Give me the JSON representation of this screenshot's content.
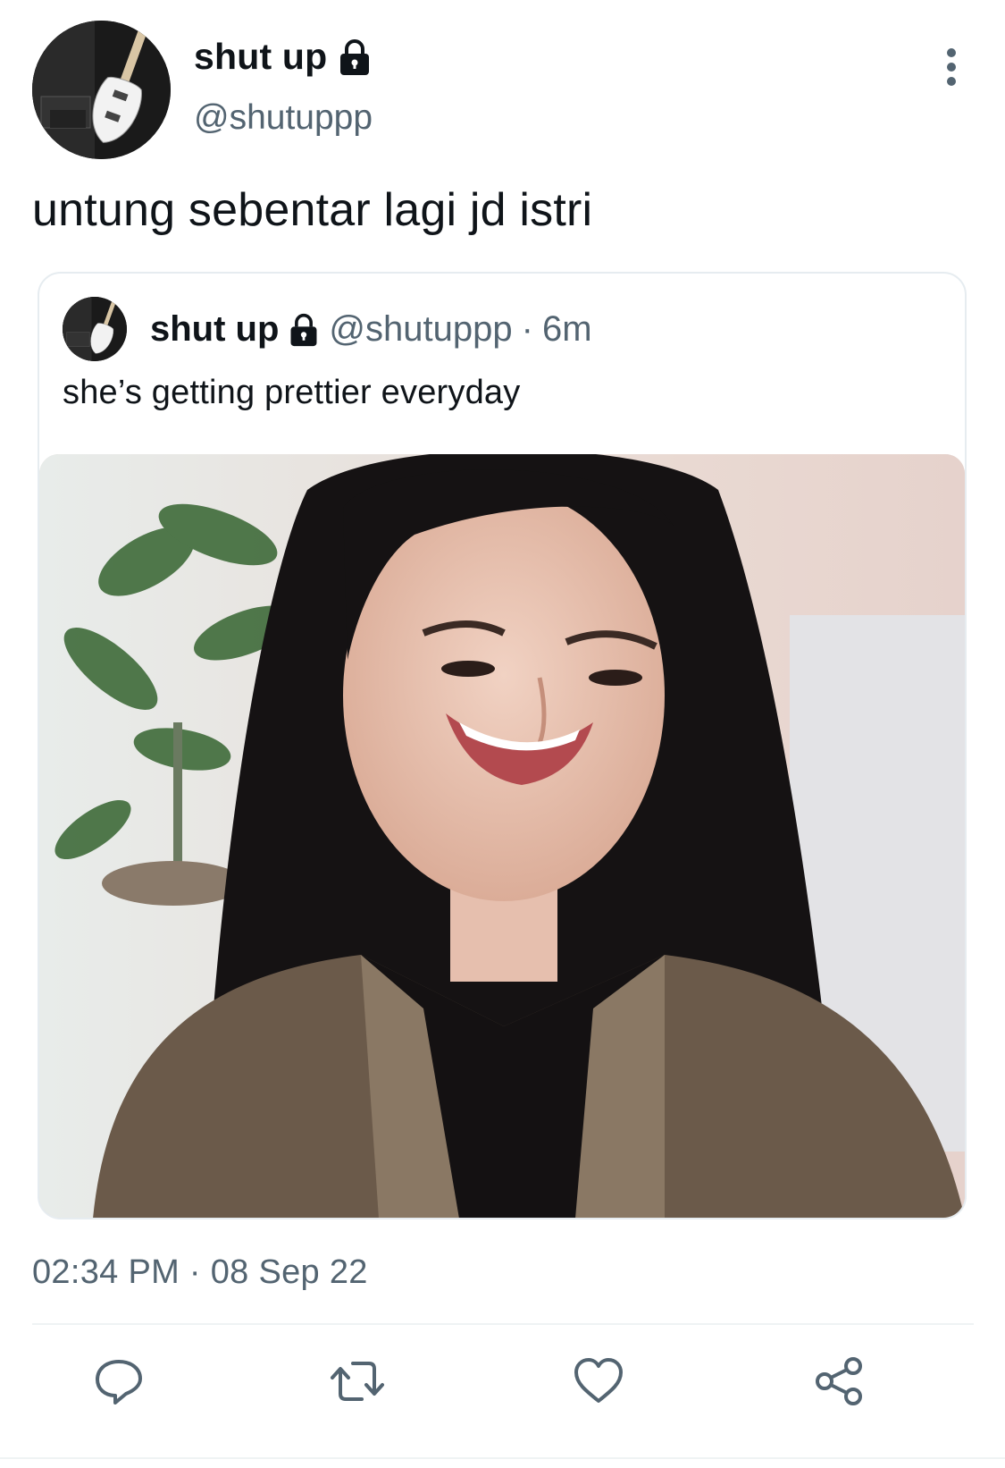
{
  "tweet": {
    "author": {
      "display_name": "shut up",
      "handle": "@shutuppp",
      "locked_icon": "lock-icon",
      "avatar": "avatar-guitar-photo"
    },
    "text": "untung sebentar lagi jd istri",
    "timestamp": "02:34 PM · 08 Sep 22"
  },
  "quoted": {
    "display_name": "shut up",
    "handle": "@shutuppp",
    "separator": "·",
    "time": "6m",
    "text": "she’s getting prettier everyday",
    "media": "photo-smiling-woman"
  },
  "actions": [
    {
      "name": "reply",
      "icon": "reply-icon"
    },
    {
      "name": "retweet",
      "icon": "retweet-icon"
    },
    {
      "name": "like",
      "icon": "heart-icon"
    },
    {
      "name": "share",
      "icon": "share-icon"
    }
  ],
  "colors": {
    "text_primary": "#0f1419",
    "text_secondary": "#536471",
    "border": "#e6ecf0"
  }
}
